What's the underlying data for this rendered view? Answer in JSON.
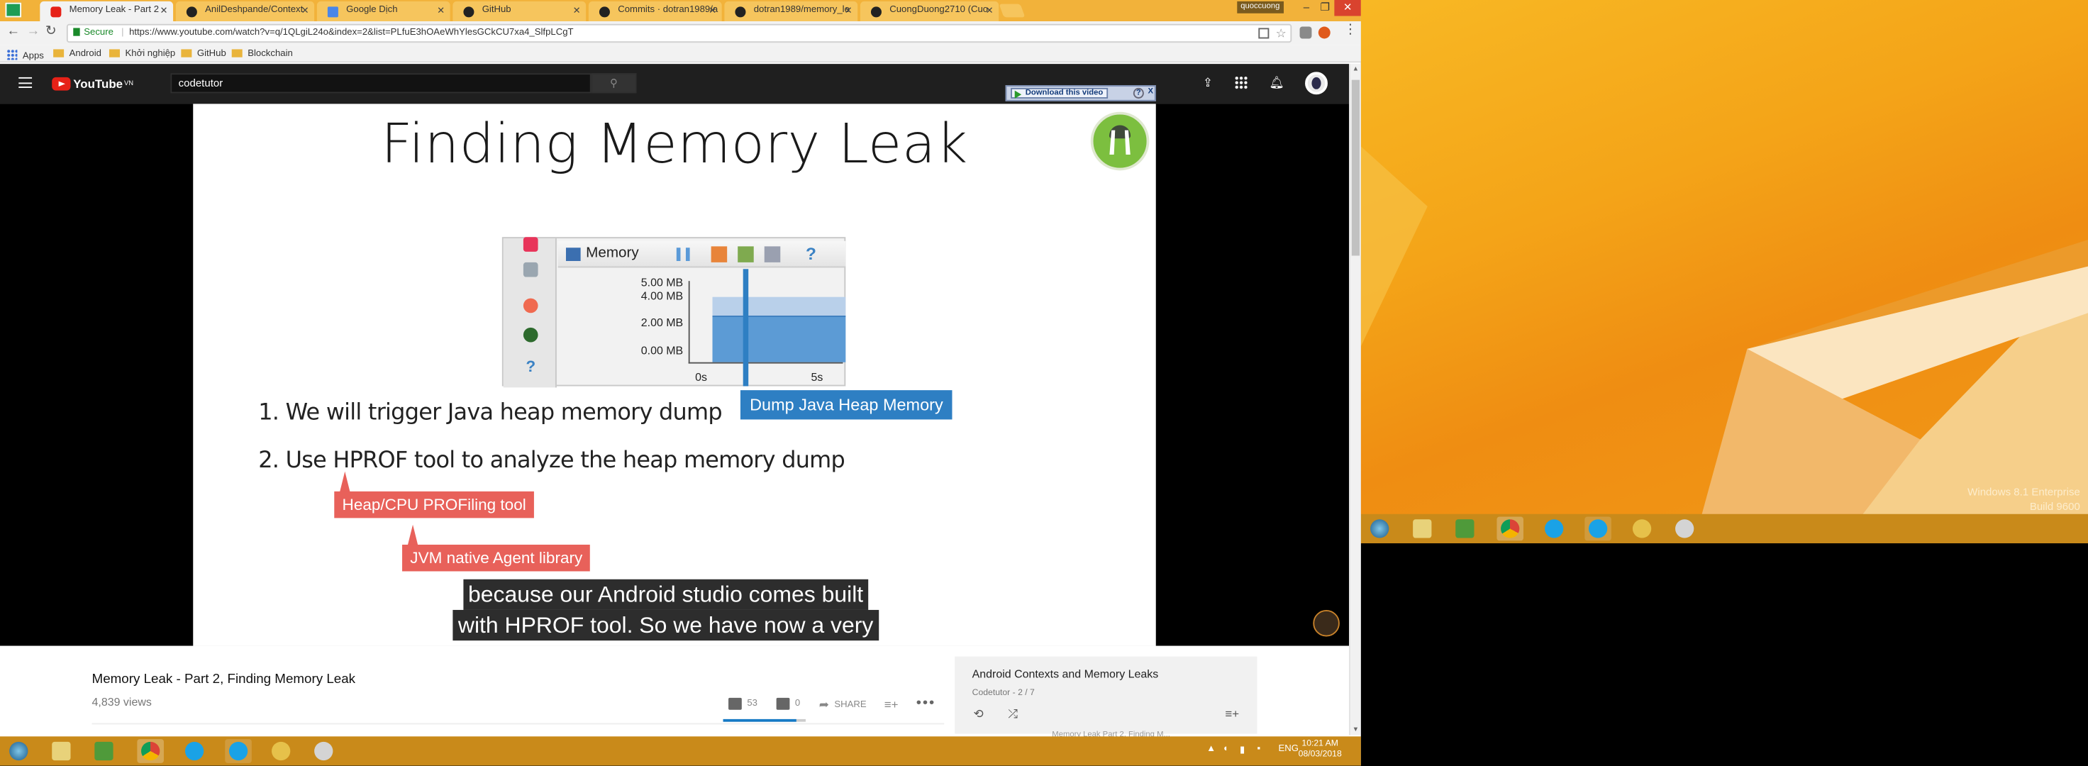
{
  "browser": {
    "tabs": [
      {
        "label": "Memory Leak - Part 2",
        "active": true
      },
      {
        "label": "AnilDeshpande/Context"
      },
      {
        "label": "Google Dịch"
      },
      {
        "label": "GitHub"
      },
      {
        "label": "Commits · dotran1989/a"
      },
      {
        "label": "dotran1989/memory_le"
      },
      {
        "label": "CuongDuong2710 (Cuo"
      }
    ],
    "user_badge": "quoccuong",
    "secure_label": "Secure",
    "url": "https://www.youtube.com/watch?v=q/1QLgiL24o&index=2&list=PLfuE3hOAeWhYlesGCkCU7xa4_SlfpLCgT",
    "bookmarks": [
      "Apps",
      "Android",
      "Khởi nghiệp",
      "GitHub",
      "Blockchain"
    ]
  },
  "youtube": {
    "logo": "YouTube",
    "logo_region": "VN",
    "search_value": "codetutor",
    "download_button": "Download this video",
    "download_help": "?",
    "download_close": "X"
  },
  "slide": {
    "title": "Finding Memory Leak",
    "panel_label": "Memory",
    "y_labels": [
      "5.00 MB",
      "4.00 MB",
      "2.00 MB",
      "0.00 MB"
    ],
    "x_labels": [
      "0s",
      "5s"
    ],
    "help_glyph": "?",
    "callout_dump": "Dump Java Heap Memory",
    "item1": "1. We will trigger Java heap memory dump",
    "item2": "2. Use HPROF tool to analyze the heap memory dump",
    "callout_hprof": "Heap/CPU PROFiling tool",
    "callout_jvm": "JVM native Agent library"
  },
  "caption": {
    "line1": "because our Android studio comes built",
    "line2": "with HPROF tool. So we have now a very"
  },
  "video": {
    "title": "Memory Leak - Part 2, Finding Memory Leak",
    "views": "4,839 views",
    "likes": "53",
    "dislikes": "0",
    "share": "SHARE",
    "like_ratio": 0.88
  },
  "playlist": {
    "title": "Android Contexts and Memory Leaks",
    "subtitle": "Codetutor - 2 / 7",
    "cut_text": "Memory Leak Part 2, Finding M..."
  },
  "taskbar": {
    "lang": "ENG",
    "time": "10:21 AM",
    "date": "08/03/2018"
  },
  "desktop": {
    "watermark_line1": "Windows 8.1 Enterprise",
    "watermark_line2": "Build 9600"
  }
}
